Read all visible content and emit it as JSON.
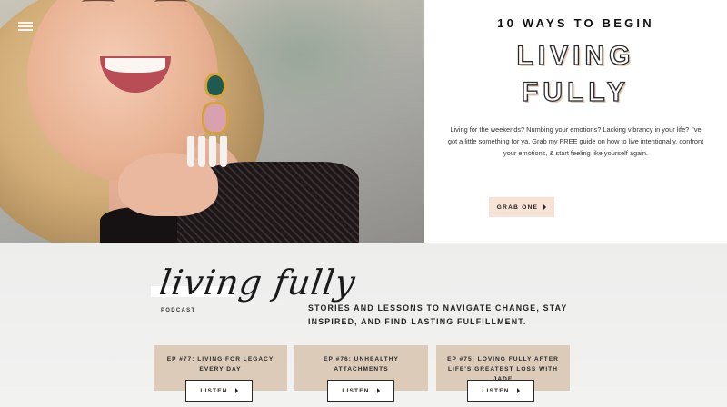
{
  "header": {
    "menu_icon": "hamburger-menu-icon"
  },
  "hero": {
    "kicker": "10 WAYS TO BEGIN",
    "title_line1": "LIVING",
    "title_line2": "FULLY",
    "description": "Living for the weekends? Numbing your emotions? Lacking vibrancy in your life? I've got a little something for ya. Grab my FREE guide on how to live intentionally, confront your emotions, & start feeling like yourself again.",
    "cta_label": "GRAB ONE",
    "cta_icon": "chevron-right-icon",
    "colors": {
      "cta_bg": "#f6e3d6",
      "title_shadow": "#e7cdbd"
    }
  },
  "podcast": {
    "script_logo": "living fully",
    "label": "PODCAST",
    "tagline": "STORIES AND LESSONS TO NAVIGATE CHANGE, STAY INSPIRED, AND FIND LASTING FULFILLMENT.",
    "episodes": [
      {
        "title": "EP #77: LIVING FOR LEGACY EVERY DAY",
        "button": "LISTEN"
      },
      {
        "title": "EP #76: UNHEALTHY ATTACHMENTS",
        "button": "LISTEN"
      },
      {
        "title": "EP #75: LOVING FULLY AFTER LIFE'S GREATEST LOSS WITH JADE",
        "button": "LISTEN"
      }
    ],
    "colors": {
      "card_bg": "#dccbb8",
      "section_bg": "#ededec"
    }
  }
}
